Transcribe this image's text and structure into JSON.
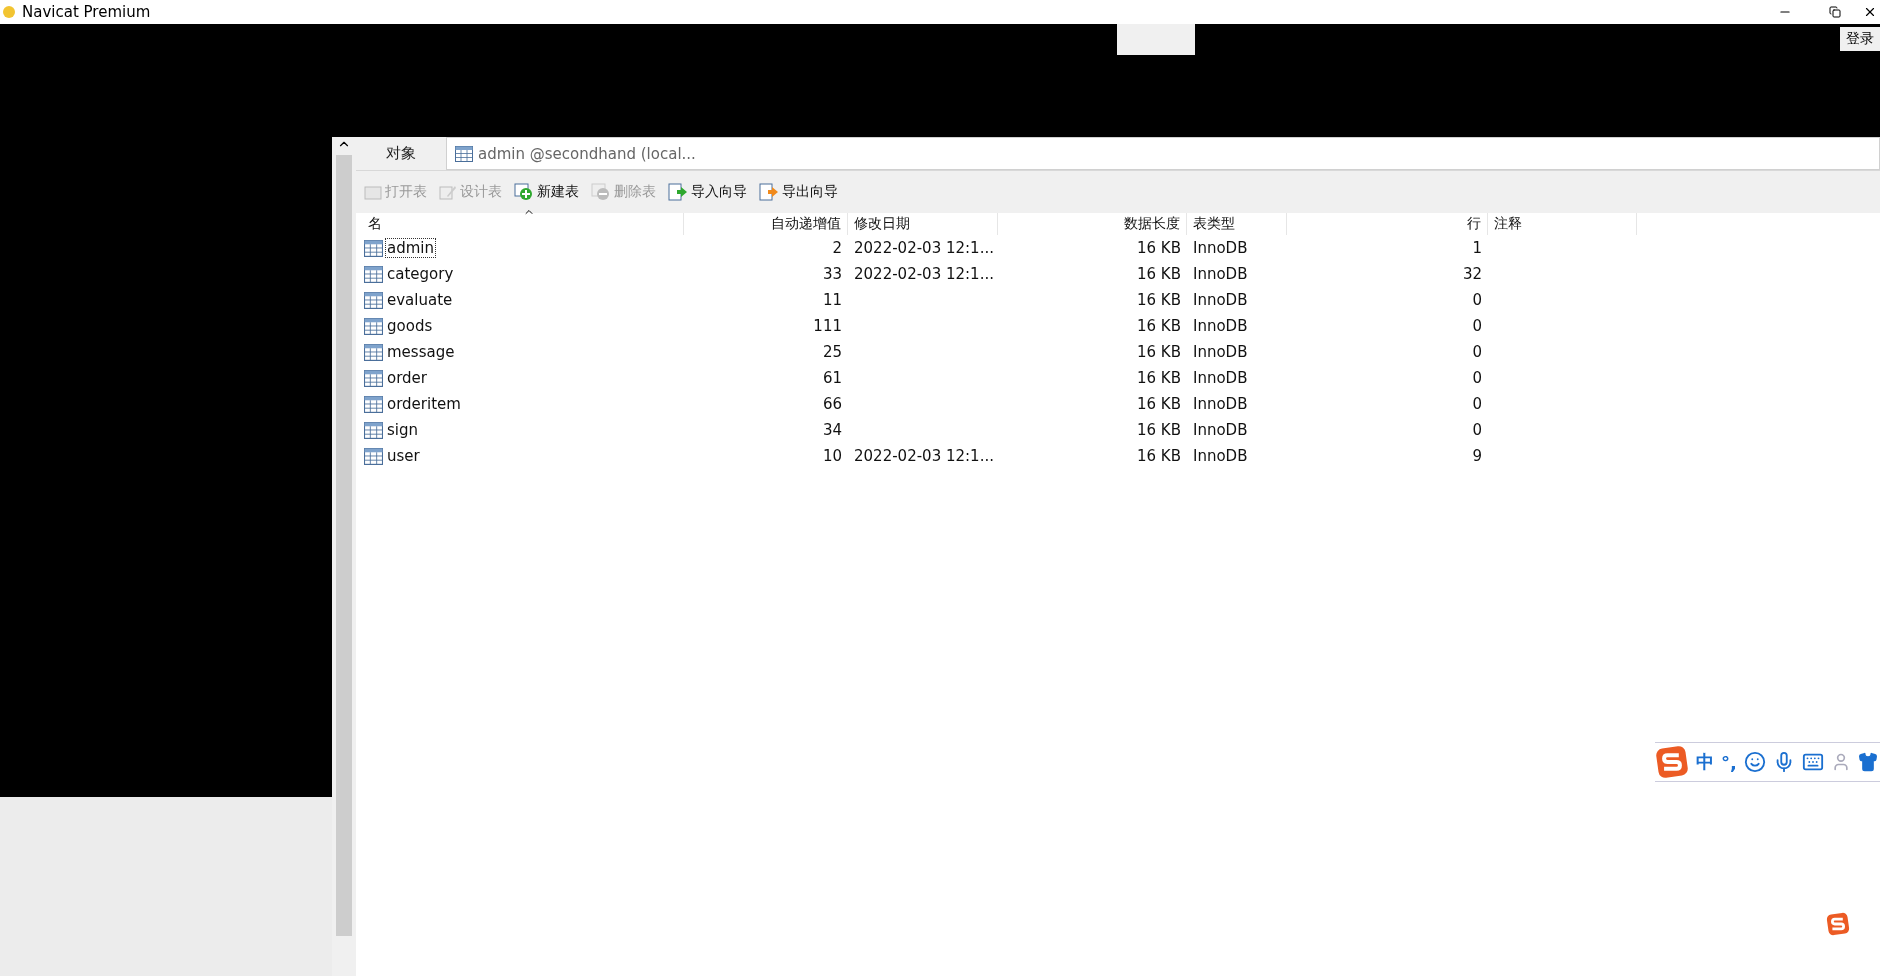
{
  "window": {
    "title": "Navicat Premium"
  },
  "login_button": "登录",
  "tabs": [
    {
      "label": "对象",
      "selected": true,
      "kind": "plain"
    },
    {
      "label": "admin @secondhand (local...",
      "selected": false,
      "kind": "table"
    }
  ],
  "toolbar": [
    {
      "label": "打开表",
      "disabled": true,
      "kind": "open"
    },
    {
      "label": "设计表",
      "disabled": true,
      "kind": "design"
    },
    {
      "label": "新建表",
      "disabled": false,
      "kind": "new"
    },
    {
      "label": "删除表",
      "disabled": true,
      "kind": "delete"
    },
    {
      "label": "导入向导",
      "disabled": false,
      "kind": "import"
    },
    {
      "label": "导出向导",
      "disabled": false,
      "kind": "export"
    }
  ],
  "table": {
    "columns": [
      {
        "label": "名",
        "kind": "text",
        "sorted": true
      },
      {
        "label": "自动递增值",
        "kind": "number",
        "sorted": false
      },
      {
        "label": "修改日期",
        "kind": "text",
        "sorted": false
      },
      {
        "label": "数据长度",
        "kind": "number",
        "sorted": false
      },
      {
        "label": "表类型",
        "kind": "text",
        "sorted": false
      },
      {
        "label": "行",
        "kind": "number",
        "sorted": false
      },
      {
        "label": "注释",
        "kind": "text",
        "sorted": false
      }
    ],
    "rows": [
      {
        "selected": true,
        "cells": [
          "admin",
          "2",
          "2022-02-03 12:1...",
          "16 KB",
          "InnoDB",
          "1",
          ""
        ]
      },
      {
        "selected": false,
        "cells": [
          "category",
          "33",
          "2022-02-03 12:1...",
          "16 KB",
          "InnoDB",
          "32",
          ""
        ]
      },
      {
        "selected": false,
        "cells": [
          "evaluate",
          "11",
          "",
          "16 KB",
          "InnoDB",
          "0",
          ""
        ]
      },
      {
        "selected": false,
        "cells": [
          "goods",
          "111",
          "",
          "16 KB",
          "InnoDB",
          "0",
          ""
        ]
      },
      {
        "selected": false,
        "cells": [
          "message",
          "25",
          "",
          "16 KB",
          "InnoDB",
          "0",
          ""
        ]
      },
      {
        "selected": false,
        "cells": [
          "order",
          "61",
          "",
          "16 KB",
          "InnoDB",
          "0",
          ""
        ]
      },
      {
        "selected": false,
        "cells": [
          "orderitem",
          "66",
          "",
          "16 KB",
          "InnoDB",
          "0",
          ""
        ]
      },
      {
        "selected": false,
        "cells": [
          "sign",
          "34",
          "",
          "16 KB",
          "InnoDB",
          "0",
          ""
        ]
      },
      {
        "selected": false,
        "cells": [
          "user",
          "10",
          "2022-02-03 12:1...",
          "16 KB",
          "InnoDB",
          "9",
          ""
        ]
      }
    ]
  },
  "ime_bar": {
    "mode": "中",
    "punct": "°,"
  }
}
